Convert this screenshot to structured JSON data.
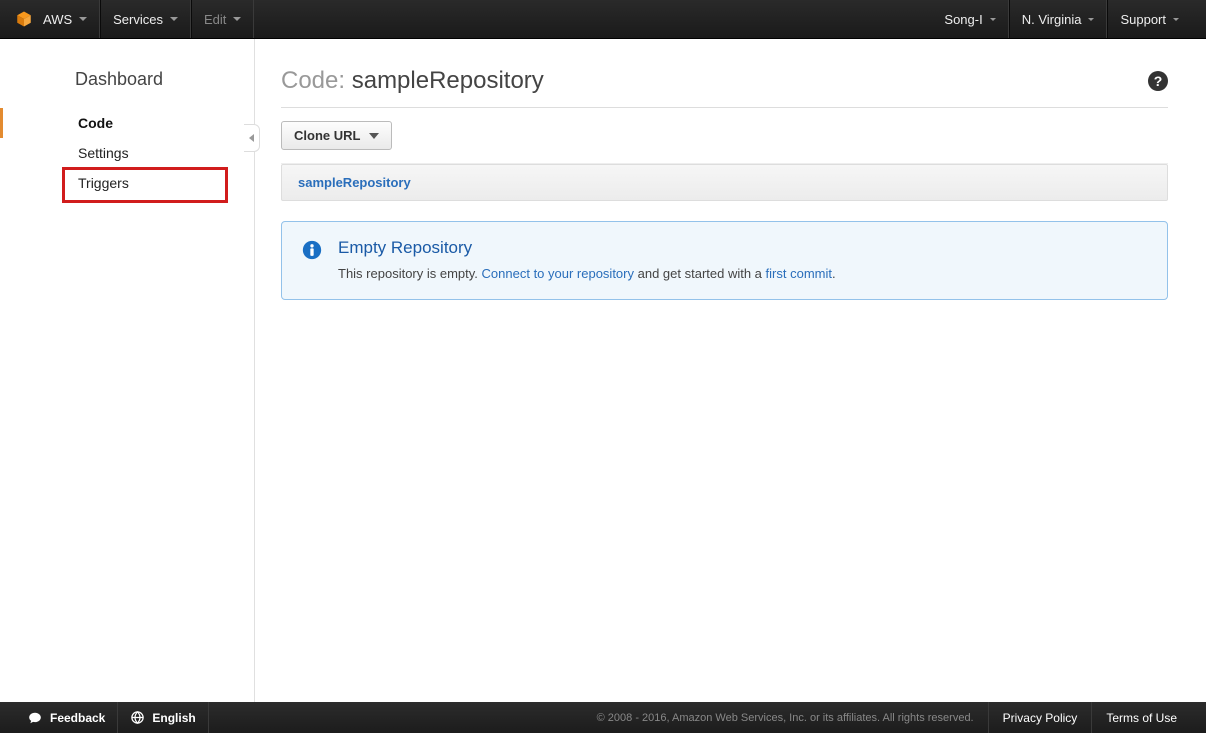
{
  "topnav": {
    "aws_label": "AWS",
    "services_label": "Services",
    "edit_label": "Edit",
    "user": "Song-I",
    "region": "N. Virginia",
    "support": "Support"
  },
  "sidebar": {
    "heading": "Dashboard",
    "items": [
      {
        "label": "Code",
        "active": true
      },
      {
        "label": "Settings",
        "active": false
      },
      {
        "label": "Triggers",
        "active": false
      }
    ]
  },
  "page": {
    "title_prefix": "Code: ",
    "repo_name": "sampleRepository",
    "clone_button": "Clone URL",
    "breadcrumb": "sampleRepository"
  },
  "info": {
    "title": "Empty Repository",
    "text_before": "This repository is empty. ",
    "link1": "Connect to your repository",
    "text_mid": " and get started with a ",
    "link2": "first commit",
    "text_after": "."
  },
  "footer": {
    "feedback": "Feedback",
    "language": "English",
    "copyright": "© 2008 - 2016, Amazon Web Services, Inc. or its affiliates. All rights reserved.",
    "privacy": "Privacy Policy",
    "terms": "Terms of Use"
  }
}
